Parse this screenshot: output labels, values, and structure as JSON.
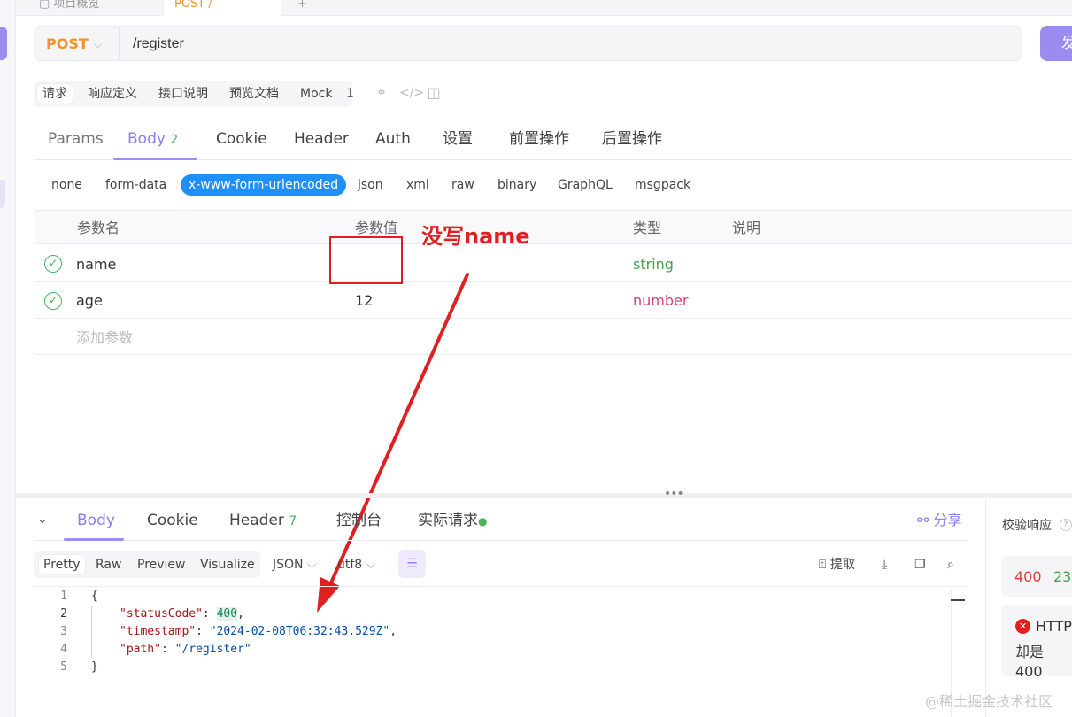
{
  "top_tabs": [
    "项目概览",
    "POST /"
  ],
  "request": {
    "method": "POST",
    "url": "/register",
    "send_label": "发"
  },
  "sub_tabs": {
    "items": [
      "请求",
      "响应定义",
      "接口说明",
      "预览文档",
      "Mock"
    ],
    "mock_count": "1"
  },
  "param_tabs": {
    "params": "Params",
    "body": "Body",
    "body_count": "2",
    "cookie": "Cookie",
    "header": "Header",
    "auth": "Auth",
    "settings": "设置",
    "pre": "前置操作",
    "post": "后置操作"
  },
  "body_types": [
    "none",
    "form-data",
    "x-www-form-urlencoded",
    "json",
    "xml",
    "raw",
    "binary",
    "GraphQL",
    "msgpack"
  ],
  "params_table": {
    "headers": [
      "参数名",
      "参数值",
      "类型",
      "说明"
    ],
    "rows": [
      {
        "name": "name",
        "value": "",
        "type": "string"
      },
      {
        "name": "age",
        "value": "12",
        "type": "number"
      }
    ],
    "add_placeholder": "添加参数"
  },
  "annotation": {
    "text": "没写name",
    "color": "#e02020"
  },
  "response_tabs": {
    "body": "Body",
    "cookie": "Cookie",
    "header": "Header",
    "header_count": "7",
    "console": "控制台",
    "actual": "实际请求",
    "share": "分享"
  },
  "response_toolbar": {
    "view_tabs": [
      "Pretty",
      "Raw",
      "Preview",
      "Visualize"
    ],
    "format": "JSON",
    "encoding": "utf8",
    "extract": "提取"
  },
  "code": {
    "line_numbers": [
      "1",
      "2",
      "3",
      "4",
      "5"
    ],
    "open": "{",
    "close": "}",
    "status_key": "\"statusCode\"",
    "status_value": "400",
    "timestamp_key": "\"timestamp\"",
    "timestamp_value": "\"2024-02-08T06:32:43.529Z\"",
    "path_key": "\"path\"",
    "path_value": "\"/register\""
  },
  "right_panel": {
    "title": "校验响应",
    "status": "400",
    "time": "23",
    "error_title": "HTTP",
    "error_line": "却是 400"
  },
  "watermark": "@稀土掘金技术社区",
  "colors": {
    "accent": "#9b8cf0",
    "method": "#f0932b",
    "active_body_type": "#1f8ffa",
    "string_type": "#47a34b",
    "number_type": "#d6407a",
    "error": "#e02020"
  }
}
